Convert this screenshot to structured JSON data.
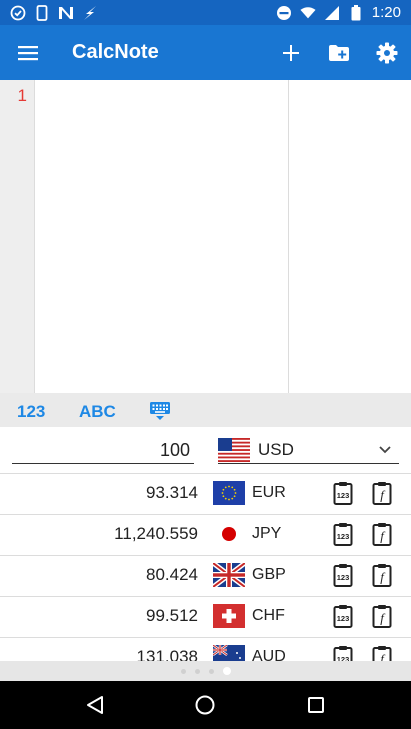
{
  "status_bar": {
    "time": "1:20",
    "left_icons": [
      "clock-check-icon",
      "phone-icon",
      "n-icon",
      "lightning-icon"
    ],
    "right_icons": [
      "do-not-disturb-icon",
      "wifi-icon",
      "signal-icon",
      "battery-icon"
    ]
  },
  "app_bar": {
    "title": "CalcNote",
    "background": "#1976d2",
    "actions": [
      "add-icon",
      "new-folder-icon",
      "settings-icon"
    ]
  },
  "editor": {
    "line_numbers": [
      "1"
    ],
    "line_number_color": "#e53935"
  },
  "keyboard_tabs": {
    "numeric_label": "123",
    "alpha_label": "ABC",
    "keyboard_icon": "keyboard-icon",
    "accent": "#1e88e5"
  },
  "converter": {
    "amount": "100",
    "base_currency": "USD",
    "base_flag": "us-flag-icon",
    "rates": [
      {
        "value": "93.314",
        "code": "EUR",
        "flag": "eu-flag-icon"
      },
      {
        "value": "11,240.559",
        "code": "JPY",
        "flag": "jp-flag-icon"
      },
      {
        "value": "80.424",
        "code": "GBP",
        "flag": "uk-flag-icon"
      },
      {
        "value": "99.512",
        "code": "CHF",
        "flag": "ch-flag-icon"
      },
      {
        "value": "131.038",
        "code": "AUD",
        "flag": "au-flag-icon"
      }
    ]
  },
  "pager": {
    "pages": 4,
    "active_index": 3
  },
  "nav_bar": {
    "buttons": [
      "back-icon",
      "home-icon",
      "recents-icon"
    ]
  }
}
